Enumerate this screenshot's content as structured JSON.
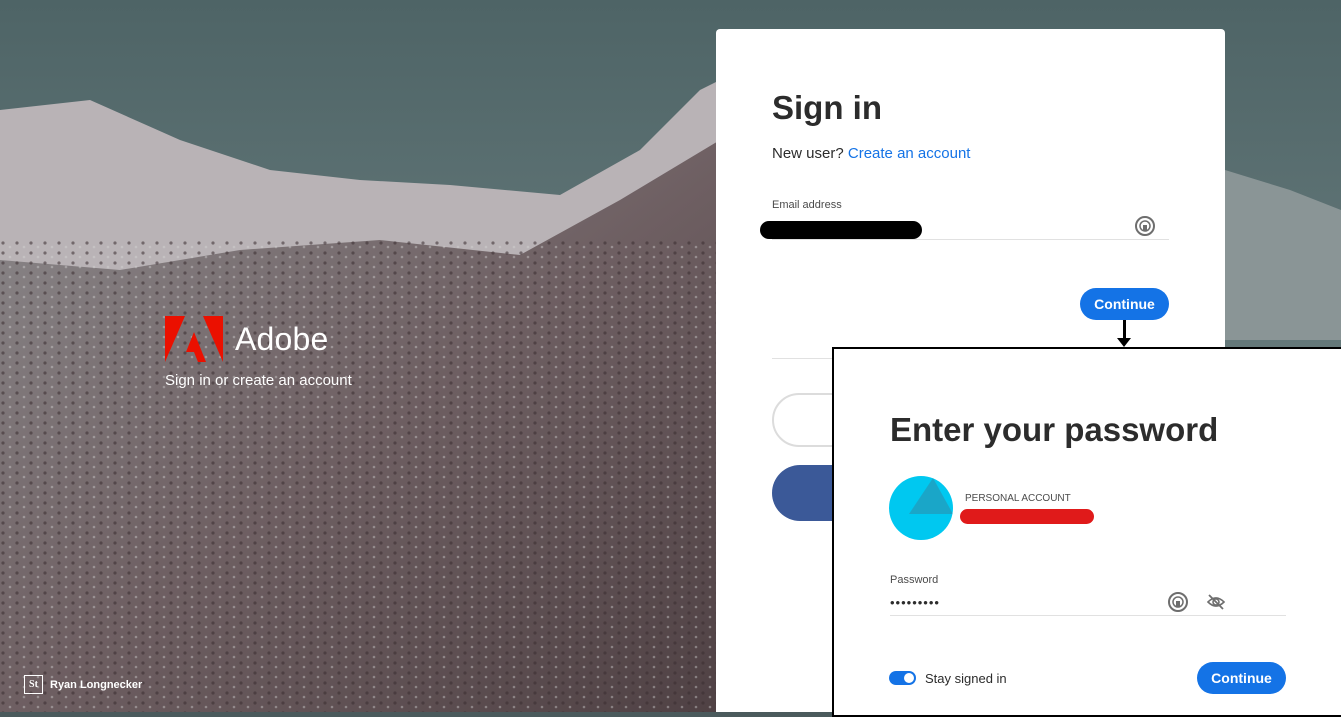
{
  "brand": {
    "name": "Adobe",
    "subtitle": "Sign in or create an account",
    "logo_color": "#eb1000"
  },
  "credit": {
    "icon_letter": "St",
    "name": "Ryan Longnecker"
  },
  "signin": {
    "title": "Sign in",
    "new_user_text": "New user?",
    "create_link": "Create an account",
    "email_label": "Email address",
    "continue_label": "Continue"
  },
  "password": {
    "title": "Enter your password",
    "account_type": "PERSONAL ACCOUNT",
    "password_label": "Password",
    "password_value": "•••••••••",
    "stay_signed_in_label": "Stay signed in",
    "stay_signed_in": true,
    "continue_label": "Continue"
  },
  "colors": {
    "accent": "#1473e6",
    "facebook": "#3b5998",
    "redaction_red": "#e01a1a",
    "avatar": "#00c8f0"
  }
}
